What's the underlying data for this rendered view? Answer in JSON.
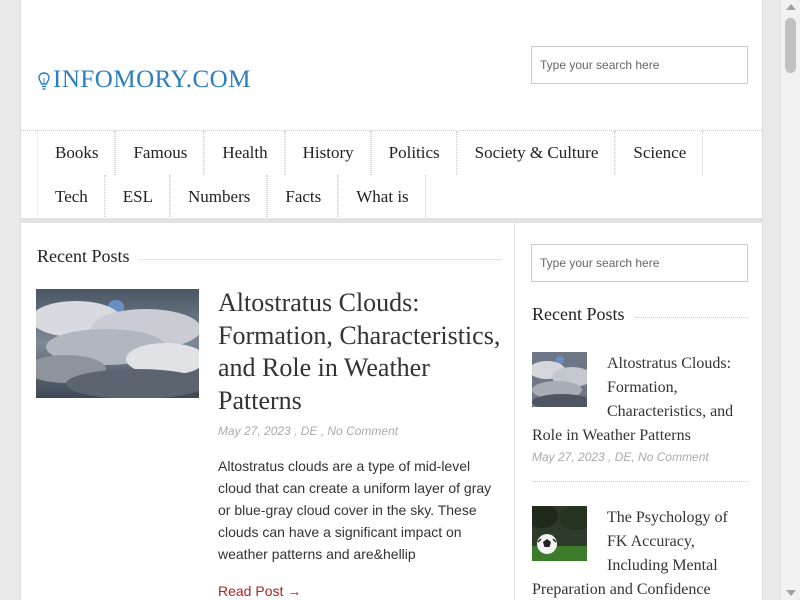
{
  "site": {
    "logo_text": "INFOMORY.COM",
    "accent": "#2a7fc0"
  },
  "search": {
    "top_placeholder": "Type your search here",
    "side_placeholder": "Type your search here"
  },
  "nav": {
    "row1": [
      "Books",
      "Famous",
      "Health",
      "History",
      "Politics",
      "Society & Culture",
      "Science"
    ],
    "row2": [
      "Tech",
      "ESL",
      "Numbers",
      "Facts",
      "What is"
    ]
  },
  "main": {
    "section_title": "Recent Posts",
    "post": {
      "title": "Altostratus Clouds: Formation, Characteristics, and Role in Weather Patterns",
      "meta": "May 27, 2023 , DE , No Comment",
      "excerpt": "Altostratus clouds are a type of mid-level cloud that can create a uniform layer of gray or blue-gray cloud cover in the sky. These clouds can have a significant impact on weather patterns and are&hellip",
      "read_more": "Read Post →"
    }
  },
  "sidebar": {
    "section_title": "Recent Posts",
    "posts": [
      {
        "title": "Altostratus Clouds: Formation, Characteristics, and Role in Weather Patterns",
        "meta": "May 27, 2023 , DE, No Comment"
      },
      {
        "title": "The Psychology of FK Accuracy, Including Mental Preparation and Confidence"
      }
    ]
  },
  "icons": {
    "logo": "lightbulb-icon",
    "thumb_clouds": "cloud-image",
    "thumb_soccer": "soccer-ball-image"
  }
}
